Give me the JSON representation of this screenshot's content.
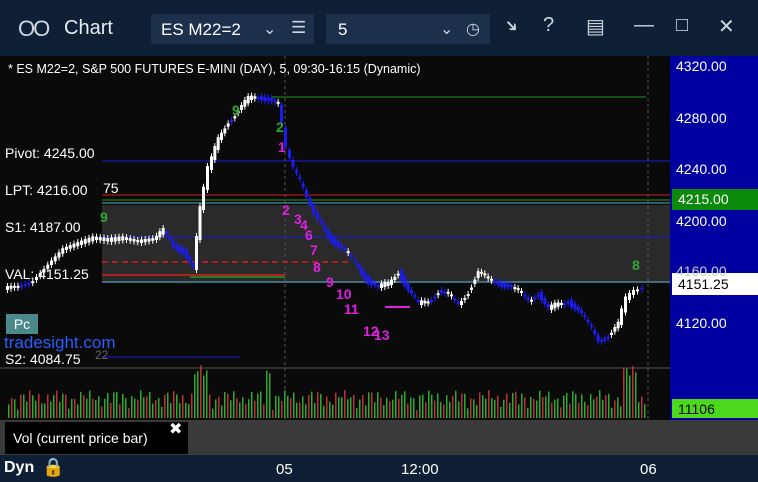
{
  "window": {
    "app_icon": "OO",
    "title": "Chart",
    "instrument": "ES M22=2",
    "interval": "5",
    "icons": {
      "instrument_dropdown": "chevron-down-icon",
      "instrument_menu": "hamburger-icon",
      "interval_dropdown": "chevron-down-icon",
      "interval_clock": "clock-icon",
      "pin": "pin-icon",
      "help": "help-icon",
      "template": "template-icon",
      "minimize": "minimize-icon",
      "maximize": "maximize-icon",
      "close": "close-icon"
    },
    "help_label": "?"
  },
  "chart_info": "* ES M22=2, S&P 500 FUTURES E-MINI (DAY), 5, 09:30-16:15 (Dynamic)",
  "levels": {
    "pivot": "Pivot: 4245.00",
    "lpt": "LPT: 4216.00",
    "lpt_extra": "75",
    "s1": "S1: 4187.00",
    "val": "VAL: 4151.25",
    "s2": "S2: 4084.75",
    "s2_extra": "22"
  },
  "badge": "Pc",
  "watermark": "tradesight.com",
  "price_axis": {
    "ticks": [
      "4320.00",
      "4280.00",
      "4240.00",
      "4200.00",
      "4160.00",
      "4120.00"
    ],
    "ranges": [
      4320,
      4120
    ],
    "marker_green": "4215.00",
    "marker_white": "4151.25",
    "volume_value": "11106"
  },
  "time_axis": [
    "05",
    "12:00",
    "06"
  ],
  "volume_label": "Vol (current price bar)",
  "volume_close": "✖",
  "statusbar": {
    "dyn": "Dyn",
    "lock_icon": "lock-icon"
  },
  "td_labels": {
    "magenta": [
      "1",
      "2",
      "3",
      "4",
      "6",
      "7",
      "8",
      "9",
      "10",
      "11",
      "12",
      "13"
    ],
    "green": [
      "9",
      "2",
      "8",
      "9"
    ]
  },
  "colors": {
    "background": "#0a0a0a",
    "titlebar": "#0e1f36",
    "axis_panel": "#0000a0",
    "pivot_line": "#1a1ad8",
    "green_line": "#1f9a1f",
    "red_line": "#d21f1f",
    "value_area": "#2a2a2a",
    "bar_up": "#ffffff",
    "bar_down": "#1c1cf0",
    "magenta": "#e020e0",
    "td_green": "#2ea82e",
    "marker_green": "#0b8a0b",
    "volume_marker": "#4cd81c"
  }
}
